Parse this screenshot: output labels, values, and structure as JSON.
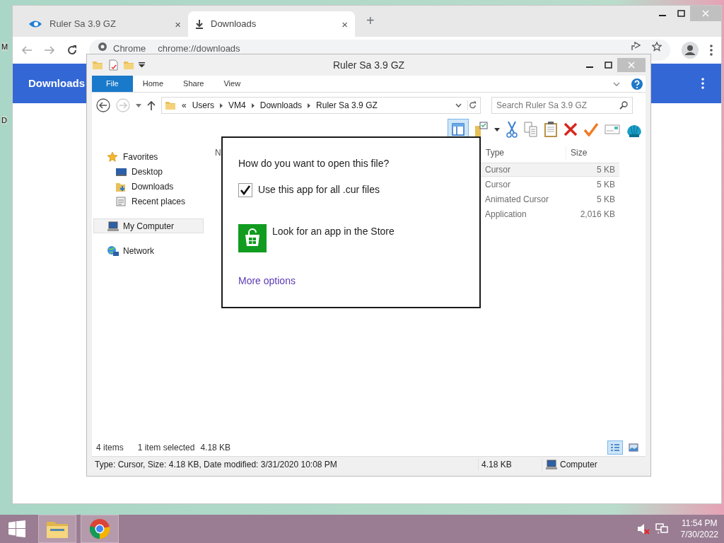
{
  "desktop": {
    "labels": [
      "M",
      "D"
    ]
  },
  "chrome": {
    "tabs": [
      {
        "title": "Ruler Sa 3.9 GZ",
        "selected": false,
        "close": "×"
      },
      {
        "title": "Downloads",
        "selected": true,
        "close": "×"
      }
    ],
    "new_tab": "+",
    "omnibox": {
      "site": "Chrome",
      "url": "chrome://downloads"
    },
    "page_title": "Downloads"
  },
  "explorer": {
    "title": "Ruler Sa 3.9 GZ",
    "ribbon_tabs": [
      {
        "label": "File",
        "selected": true
      },
      {
        "label": "Home",
        "selected": false
      },
      {
        "label": "Share",
        "selected": false
      },
      {
        "label": "View",
        "selected": false
      }
    ],
    "breadcrumb_overflow": "«",
    "path": [
      "Users",
      "VM4",
      "Downloads",
      "Ruler Sa 3.9 GZ"
    ],
    "search": {
      "placeholder": "Search Ruler Sa 3.9 GZ"
    },
    "nav": [
      {
        "label": "Favorites",
        "selected": false,
        "children": [
          {
            "label": "Desktop",
            "selected": false
          },
          {
            "label": "Downloads",
            "selected": false
          },
          {
            "label": "Recent places",
            "selected": false
          }
        ]
      },
      {
        "label": "My Computer",
        "selected": true
      },
      {
        "label": "Network",
        "selected": false
      }
    ],
    "columns": [
      "N",
      "Type",
      "Size"
    ],
    "rows": [
      {
        "type": "Cursor",
        "size": "5 KB",
        "selected": true
      },
      {
        "type": "Cursor",
        "size": "5 KB",
        "selected": false
      },
      {
        "type": "Animated Cursor",
        "size": "5 KB",
        "selected": false
      },
      {
        "type": "Application",
        "size": "2,016 KB",
        "selected": false
      }
    ],
    "status": {
      "count": "4 items",
      "selection": "1 item selected",
      "selection_size": "4.18 KB"
    },
    "details": {
      "info": "Type: Cursor, Size: 4.18 KB, Date modified: 3/31/2020 10:08 PM",
      "size": "4.18 KB",
      "location": "Computer"
    }
  },
  "dialog": {
    "question": "How do you want to open this file?",
    "checkbox": {
      "label": "Use this app for all .cur files",
      "checked": true
    },
    "store": "Look for an app in the Store",
    "more": "More options"
  },
  "taskbar": {
    "apps": [
      {
        "kind": "explorer",
        "selected": true
      },
      {
        "kind": "chrome",
        "selected": true
      }
    ],
    "clock": {
      "time": "11:54 PM",
      "date": "7/30/2022"
    }
  }
}
